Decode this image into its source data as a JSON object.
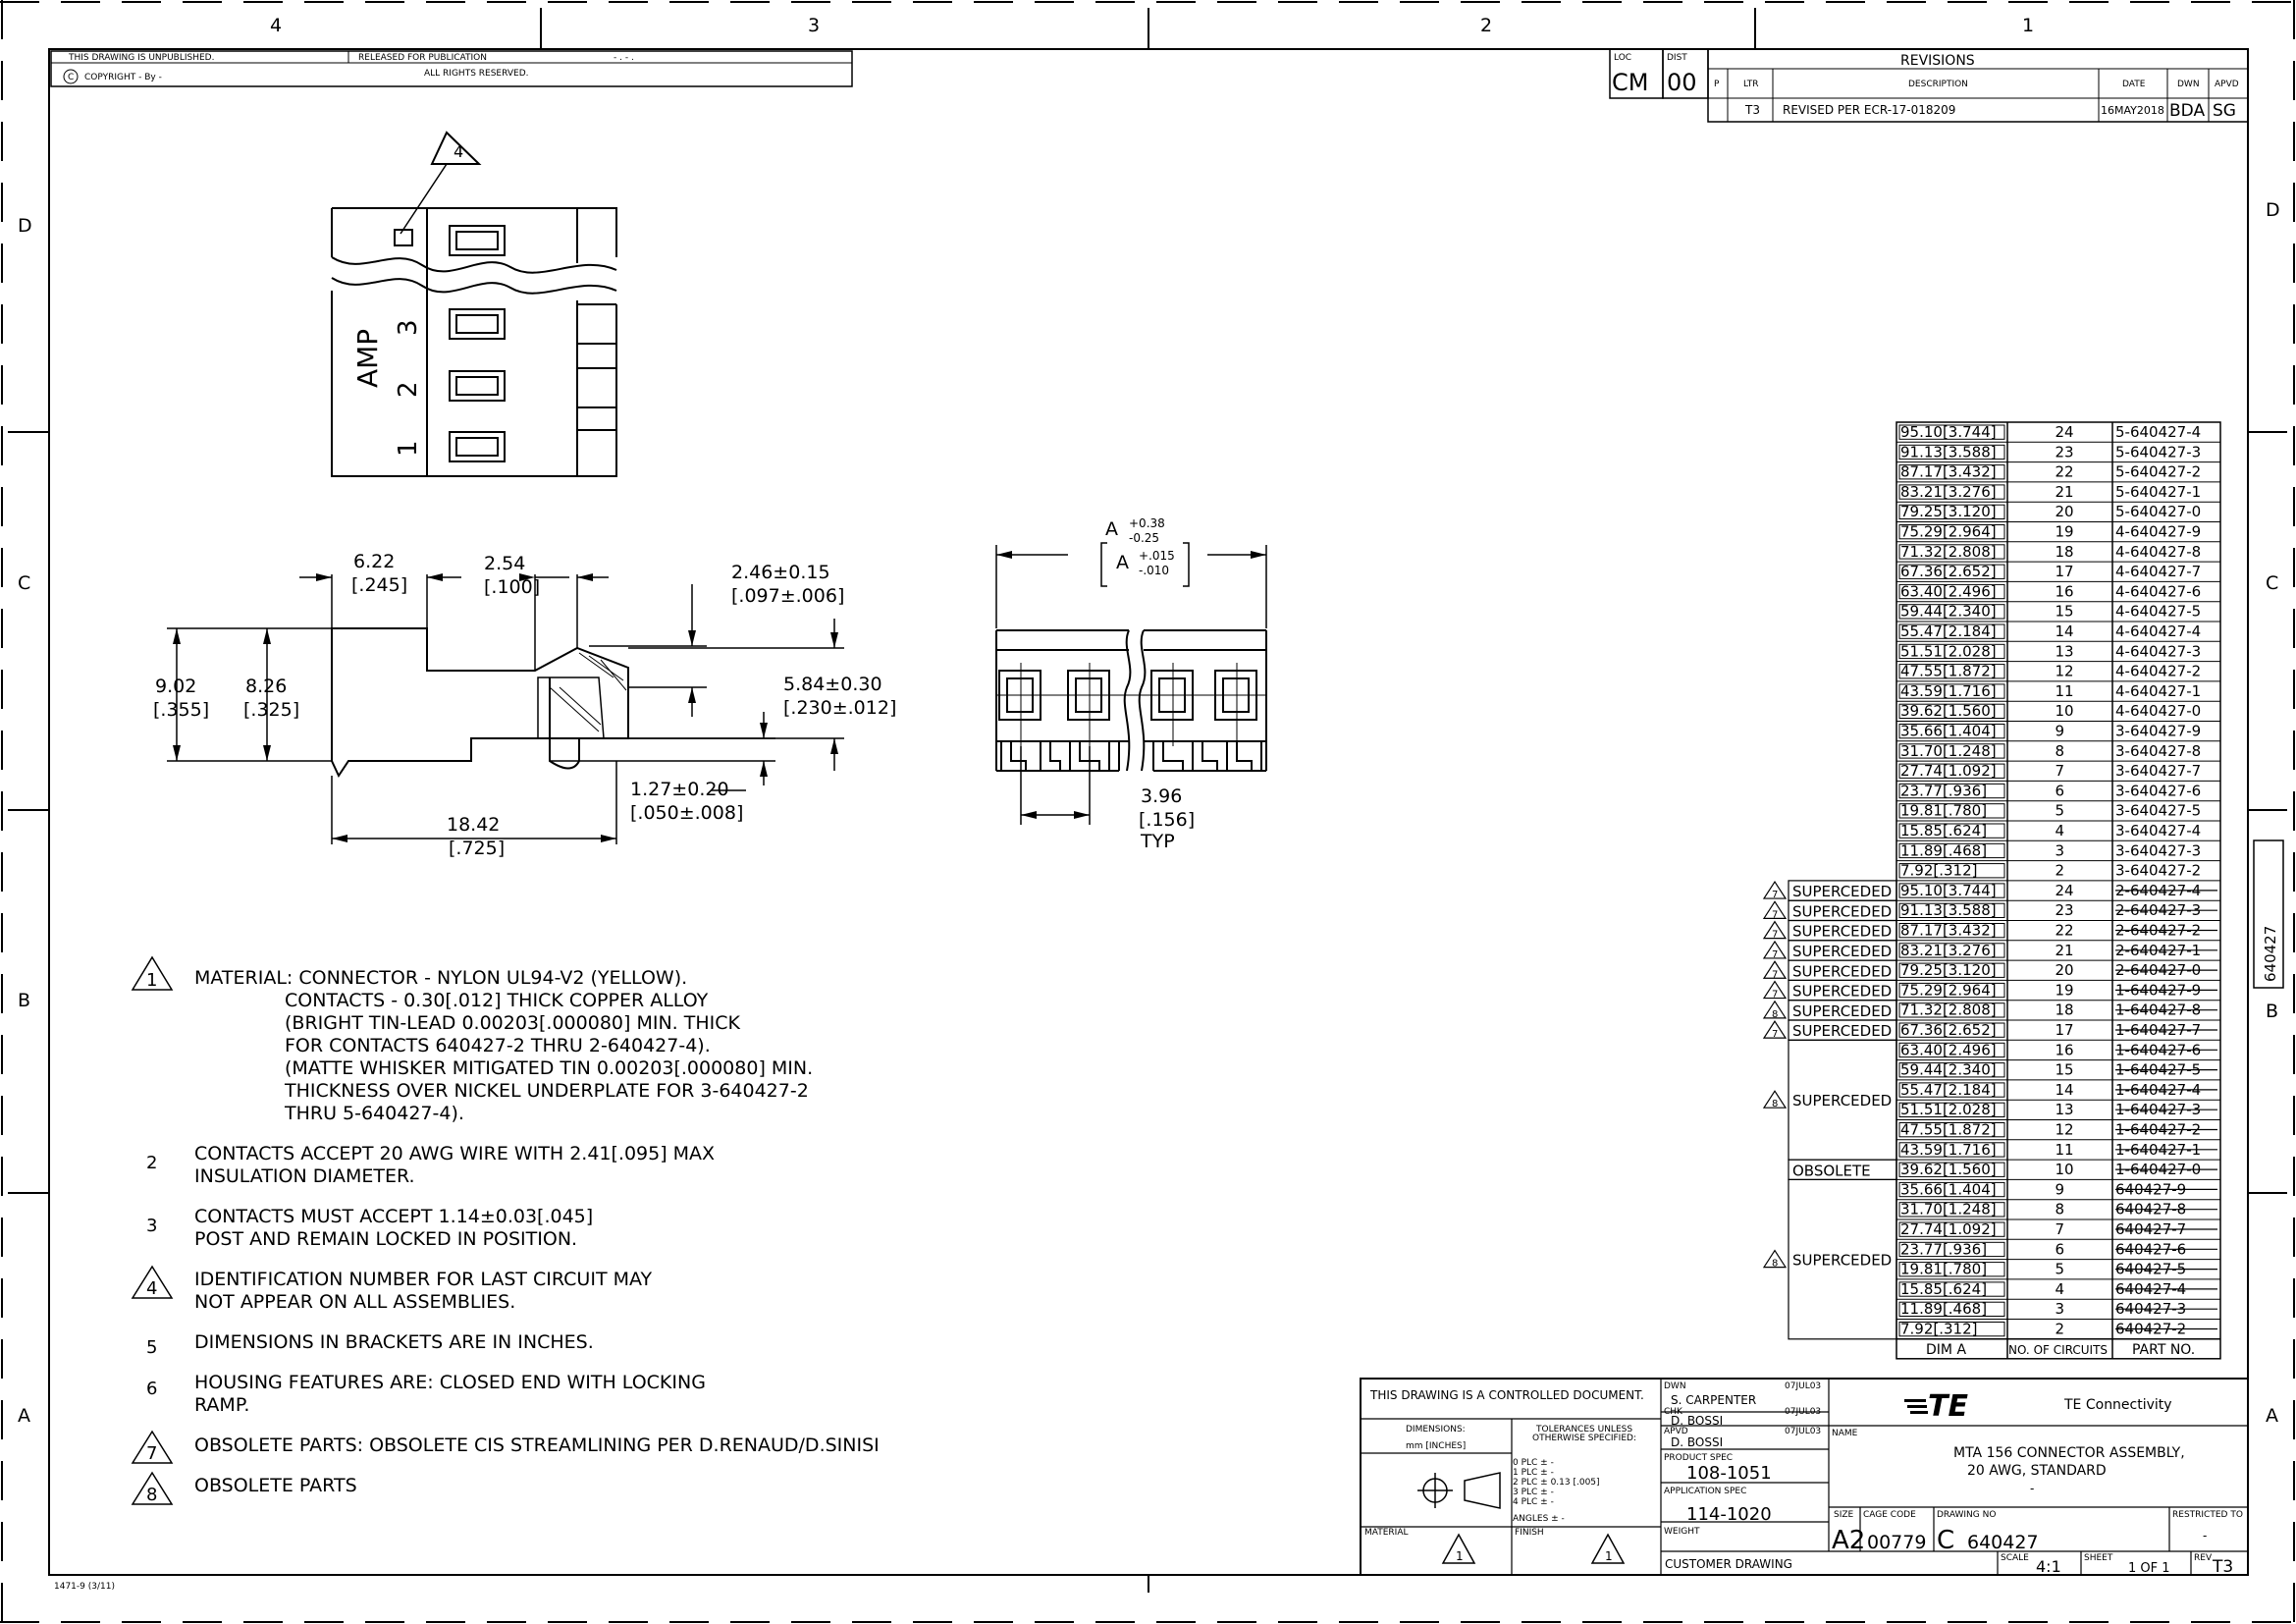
{
  "zones": {
    "columns": [
      "4",
      "3",
      "2",
      "1"
    ],
    "rows": [
      "D",
      "C",
      "B",
      "A"
    ]
  },
  "header": {
    "unpublished": "THIS DRAWING IS UNPUBLISHED.",
    "released": "RELEASED FOR PUBLICATION",
    "release_dash": "- . -   .",
    "copyright": "COPYRIGHT   -    By   -",
    "rights": "ALL RIGHTS RESERVED."
  },
  "revisions": {
    "title": "REVISIONS",
    "loc_label": "LOC",
    "loc": "CM",
    "dist_label": "DIST",
    "dist": "00",
    "cols": [
      "P",
      "LTR",
      "DESCRIPTION",
      "DATE",
      "DWN",
      "APVD"
    ],
    "row": {
      "ltr": "T3",
      "desc": "REVISED PER ECR-17-018209",
      "date": "16MAY2018",
      "dwn": "BDA",
      "apvd": "SG"
    }
  },
  "views": {
    "callout4": "4",
    "amp": "AMP",
    "pins": [
      "3",
      "2",
      "1"
    ],
    "dims": {
      "d622": "6.22",
      "d622i": "[.245]",
      "d254": "2.54",
      "d254i": "[.100]",
      "d246": "2.46±0.15",
      "d246i": "[.097±.006]",
      "d902": "9.02",
      "d902i": "[.355]",
      "d826": "8.26",
      "d826i": "[.325]",
      "d584": "5.84±0.30",
      "d584i": "[.230±.012]",
      "d127": "1.27±0.20",
      "d127i": "[.050±.008]",
      "d1842": "18.42",
      "d1842i": "[.725]",
      "a": "A",
      "atol1": "+0.38",
      "atol2": "-0.25",
      "atolin1": "+.015",
      "atolin2": "-.010",
      "d396": "3.96",
      "d396i": "[.156]",
      "typ": "TYP"
    }
  },
  "notes": {
    "n1": "MATERIAL: CONNECTOR - NYLON UL94-V2 (YELLOW).",
    "n1b": "CONTACTS - 0.30[.012] THICK COPPER ALLOY",
    "n1c": "(BRIGHT TIN-LEAD 0.00203[.000080] MIN. THICK",
    "n1d": "FOR CONTACTS 640427-2 THRU 2-640427-4).",
    "n1e": "(MATTE WHISKER MITIGATED TIN 0.00203[.000080] MIN.",
    "n1f": "THICKNESS OVER NICKEL UNDERPLATE FOR 3-640427-2",
    "n1g": "THRU 5-640427-4).",
    "n2": "CONTACTS ACCEPT 20 AWG WIRE WITH 2.41[.095] MAX",
    "n2b": "INSULATION DIAMETER.",
    "n3": "CONTACTS MUST ACCEPT 1.14±0.03[.045]",
    "n3b": "POST AND REMAIN LOCKED IN POSITION.",
    "n4": "IDENTIFICATION NUMBER FOR LAST CIRCUIT MAY",
    "n4b": "NOT APPEAR ON ALL ASSEMBLIES.",
    "n5": "DIMENSIONS IN BRACKETS ARE IN INCHES.",
    "n6": "HOUSING FEATURES ARE: CLOSED END WITH LOCKING",
    "n6b": "RAMP.",
    "n7": "OBSOLETE PARTS: OBSOLETE CIS STREAMLINING PER D.RENAUD/D.SINISI",
    "n8": "OBSOLETE PARTS",
    "nums": [
      "1",
      "2",
      "3",
      "4",
      "5",
      "6",
      "7",
      "8"
    ]
  },
  "parts_table": {
    "headers": [
      "DIM A",
      "NO. OF CIRCUITS",
      "PART NO."
    ],
    "rows": [
      {
        "dim": "95.10[3.744]",
        "n": "24",
        "part": "5-640427-4"
      },
      {
        "dim": "91.13[3.588]",
        "n": "23",
        "part": "5-640427-3"
      },
      {
        "dim": "87.17[3.432]",
        "n": "22",
        "part": "5-640427-2"
      },
      {
        "dim": "83.21[3.276]",
        "n": "21",
        "part": "5-640427-1"
      },
      {
        "dim": "79.25[3.120]",
        "n": "20",
        "part": "5-640427-0"
      },
      {
        "dim": "75.29[2.964]",
        "n": "19",
        "part": "4-640427-9"
      },
      {
        "dim": "71.32[2.808]",
        "n": "18",
        "part": "4-640427-8"
      },
      {
        "dim": "67.36[2.652]",
        "n": "17",
        "part": "4-640427-7"
      },
      {
        "dim": "63.40[2.496]",
        "n": "16",
        "part": "4-640427-6"
      },
      {
        "dim": "59.44[2.340]",
        "n": "15",
        "part": "4-640427-5"
      },
      {
        "dim": "55.47[2.184]",
        "n": "14",
        "part": "4-640427-4"
      },
      {
        "dim": "51.51[2.028]",
        "n": "13",
        "part": "4-640427-3"
      },
      {
        "dim": "47.55[1.872]",
        "n": "12",
        "part": "4-640427-2"
      },
      {
        "dim": "43.59[1.716]",
        "n": "11",
        "part": "4-640427-1"
      },
      {
        "dim": "39.62[1.560]",
        "n": "10",
        "part": "4-640427-0"
      },
      {
        "dim": "35.66[1.404]",
        "n": "9",
        "part": "3-640427-9"
      },
      {
        "dim": "31.70[1.248]",
        "n": "8",
        "part": "3-640427-8"
      },
      {
        "dim": "27.74[1.092]",
        "n": "7",
        "part": "3-640427-7"
      },
      {
        "dim": "23.77[.936]",
        "n": "6",
        "part": "3-640427-6"
      },
      {
        "dim": "19.81[.780]",
        "n": "5",
        "part": "3-640427-5"
      },
      {
        "dim": "15.85[.624]",
        "n": "4",
        "part": "3-640427-4"
      },
      {
        "dim": "11.89[.468]",
        "n": "3",
        "part": "3-640427-3"
      },
      {
        "dim": "7.92[.312]",
        "n": "2",
        "part": "3-640427-2"
      },
      {
        "dim": "95.10[3.744]",
        "n": "24",
        "part": "2-640427-4"
      },
      {
        "dim": "91.13[3.588]",
        "n": "23",
        "part": "2-640427-3"
      },
      {
        "dim": "87.17[3.432]",
        "n": "22",
        "part": "2-640427-2"
      },
      {
        "dim": "83.21[3.276]",
        "n": "21",
        "part": "2-640427-1"
      },
      {
        "dim": "79.25[3.120]",
        "n": "20",
        "part": "2-640427-0"
      },
      {
        "dim": "75.29[2.964]",
        "n": "19",
        "part": "1-640427-9"
      },
      {
        "dim": "71.32[2.808]",
        "n": "18",
        "part": "1-640427-8"
      },
      {
        "dim": "67.36[2.652]",
        "n": "17",
        "part": "1-640427-7"
      },
      {
        "dim": "63.40[2.496]",
        "n": "16",
        "part": "1-640427-6"
      },
      {
        "dim": "59.44[2.340]",
        "n": "15",
        "part": "1-640427-5"
      },
      {
        "dim": "55.47[2.184]",
        "n": "14",
        "part": "1-640427-4"
      },
      {
        "dim": "51.51[2.028]",
        "n": "13",
        "part": "1-640427-3"
      },
      {
        "dim": "47.55[1.872]",
        "n": "12",
        "part": "1-640427-2"
      },
      {
        "dim": "43.59[1.716]",
        "n": "11",
        "part": "1-640427-1"
      },
      {
        "dim": "39.62[1.560]",
        "n": "10",
        "part": "1-640427-0"
      },
      {
        "dim": "35.66[1.404]",
        "n": "9",
        "part": "640427-9"
      },
      {
        "dim": "31.70[1.248]",
        "n": "8",
        "part": "640427-8"
      },
      {
        "dim": "27.74[1.092]",
        "n": "7",
        "part": "640427-7"
      },
      {
        "dim": "23.77[.936]",
        "n": "6",
        "part": "640427-6"
      },
      {
        "dim": "19.81[.780]",
        "n": "5",
        "part": "640427-5"
      },
      {
        "dim": "15.85[.624]",
        "n": "4",
        "part": "640427-4"
      },
      {
        "dim": "11.89[.468]",
        "n": "3",
        "part": "640427-3"
      },
      {
        "dim": "7.92[.312]",
        "n": "2",
        "part": "640427-2"
      }
    ],
    "status": [
      {
        "label": "SUPERCEDED",
        "tri": "7"
      },
      {
        "label": "SUPERCEDED",
        "tri": "7"
      },
      {
        "label": "SUPERCEDED",
        "tri": "7"
      },
      {
        "label": "SUPERCEDED",
        "tri": "7"
      },
      {
        "label": "SUPERCEDED",
        "tri": "7"
      },
      {
        "label": "SUPERCEDED",
        "tri": "7"
      },
      {
        "label": "SUPERCEDED",
        "tri": "8"
      },
      {
        "label": "SUPERCEDED",
        "tri": "7"
      },
      {
        "label": "SUPERCEDED",
        "tri": "8"
      },
      {
        "label": "OBSOLETE",
        "tri": ""
      },
      {
        "label": "SUPERCEDED",
        "tri": "8"
      }
    ]
  },
  "title_block": {
    "controlled": "THIS DRAWING IS A CONTROLLED DOCUMENT.",
    "dims_label": "DIMENSIONS:",
    "dims_unit": "mm [INCHES]",
    "tol1": "TOLERANCES UNLESS",
    "tol2": "OTHERWISE SPECIFIED:",
    "tol_rows": [
      "0 PLC    ± -",
      "1 PLC    ± -",
      "2 PLC    ± 0.13 [.005]",
      "3 PLC    ± -",
      "4 PLC    ± -",
      "ANGLES       ± -"
    ],
    "material": "MATERIAL",
    "finish": "FINISH",
    "tri1": "1",
    "dwn_label": "DWN",
    "dwn": "S. CARPENTER",
    "dwn_date": "07JUL03",
    "chk_label": "CHK",
    "chk": "D. BOSSI",
    "chk_date": "07JUL03",
    "apvd_label": "APVD",
    "apvd": "D. BOSSI",
    "apvd_date": "07JUL03",
    "product_spec_label": "PRODUCT SPEC",
    "product_spec": "108-1051",
    "app_spec_label": "APPLICATION SPEC",
    "app_spec": "114-1020",
    "weight_label": "WEIGHT",
    "customer": "CUSTOMER DRAWING",
    "logo": "TE",
    "company": "TE Connectivity",
    "name_label": "NAME",
    "name1": "MTA 156 CONNECTOR ASSEMBLY,",
    "name2": "20 AWG, STANDARD",
    "name3": "-",
    "size_label": "SIZE",
    "size": "A2",
    "cage_label": "CAGE CODE",
    "cage": "00779",
    "dwg_label": "DRAWING NO",
    "dwg_prefix": "C",
    "dwg": "640427",
    "restricted_label": "RESTRICTED TO",
    "restricted": "-",
    "scale_label": "SCALE",
    "scale": "4:1",
    "sheet_label": "SHEET",
    "sheet": "1 OF 1",
    "rev_label": "REV",
    "rev": "T3"
  },
  "side_tab": "640427",
  "form_no": "1471-9  (3/11)"
}
